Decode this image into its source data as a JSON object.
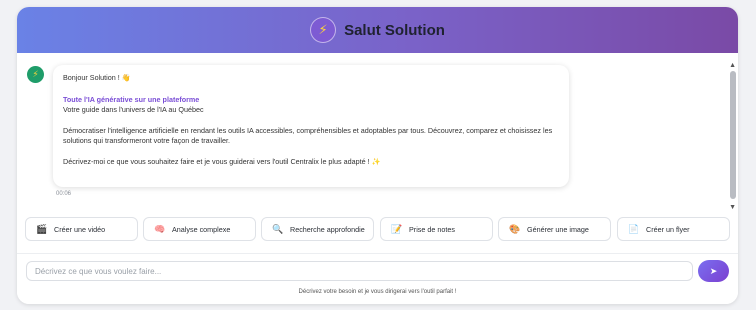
{
  "header": {
    "title": "Salut Solution",
    "logo_icon": "lightning-icon"
  },
  "chat": {
    "messages": [
      {
        "sender": "bot",
        "greeting": "Bonjour Solution ! 👋",
        "headline": "Toute l'IA générative sur une plateforme",
        "subtitle": "Votre guide dans l'univers de l'IA au Québec",
        "body": "Démocratiser l'intelligence artificielle en rendant les outils IA accessibles, compréhensibles et adoptables par tous. Découvrez, comparez et choisissez les solutions qui transformeront votre façon de travailler.",
        "prompt": "Décrivez-moi ce que vous souhaitez faire et je vous guiderai vers l'outil Centralix le plus adapté ! ✨",
        "time": "00:06"
      }
    ]
  },
  "suggestions": [
    {
      "icon": "clapperboard-icon",
      "glyph": "🎬",
      "label": "Créer une vidéo"
    },
    {
      "icon": "brain-icon",
      "glyph": "🧠",
      "label": "Analyse complexe"
    },
    {
      "icon": "magnifier-icon",
      "glyph": "🔍",
      "label": "Recherche approfondie"
    },
    {
      "icon": "notepad-icon",
      "glyph": "📝",
      "label": "Prise de notes"
    },
    {
      "icon": "palette-icon",
      "glyph": "🎨",
      "label": "Générer une image"
    },
    {
      "icon": "document-icon",
      "glyph": "📄",
      "label": "Créer un flyer"
    }
  ],
  "input": {
    "placeholder": "Décrivez ce que vous voulez faire...",
    "value": "",
    "send_icon": "send-arrow-icon",
    "hint": "Décrivez votre besoin et je vous dirigerai vers l'outil parfait !"
  },
  "colors": {
    "header_gradient_start": "#6a82e6",
    "header_gradient_end": "#7a4aa6",
    "accent": "#7b4fd6",
    "bot_avatar": "#1f9d6a"
  }
}
